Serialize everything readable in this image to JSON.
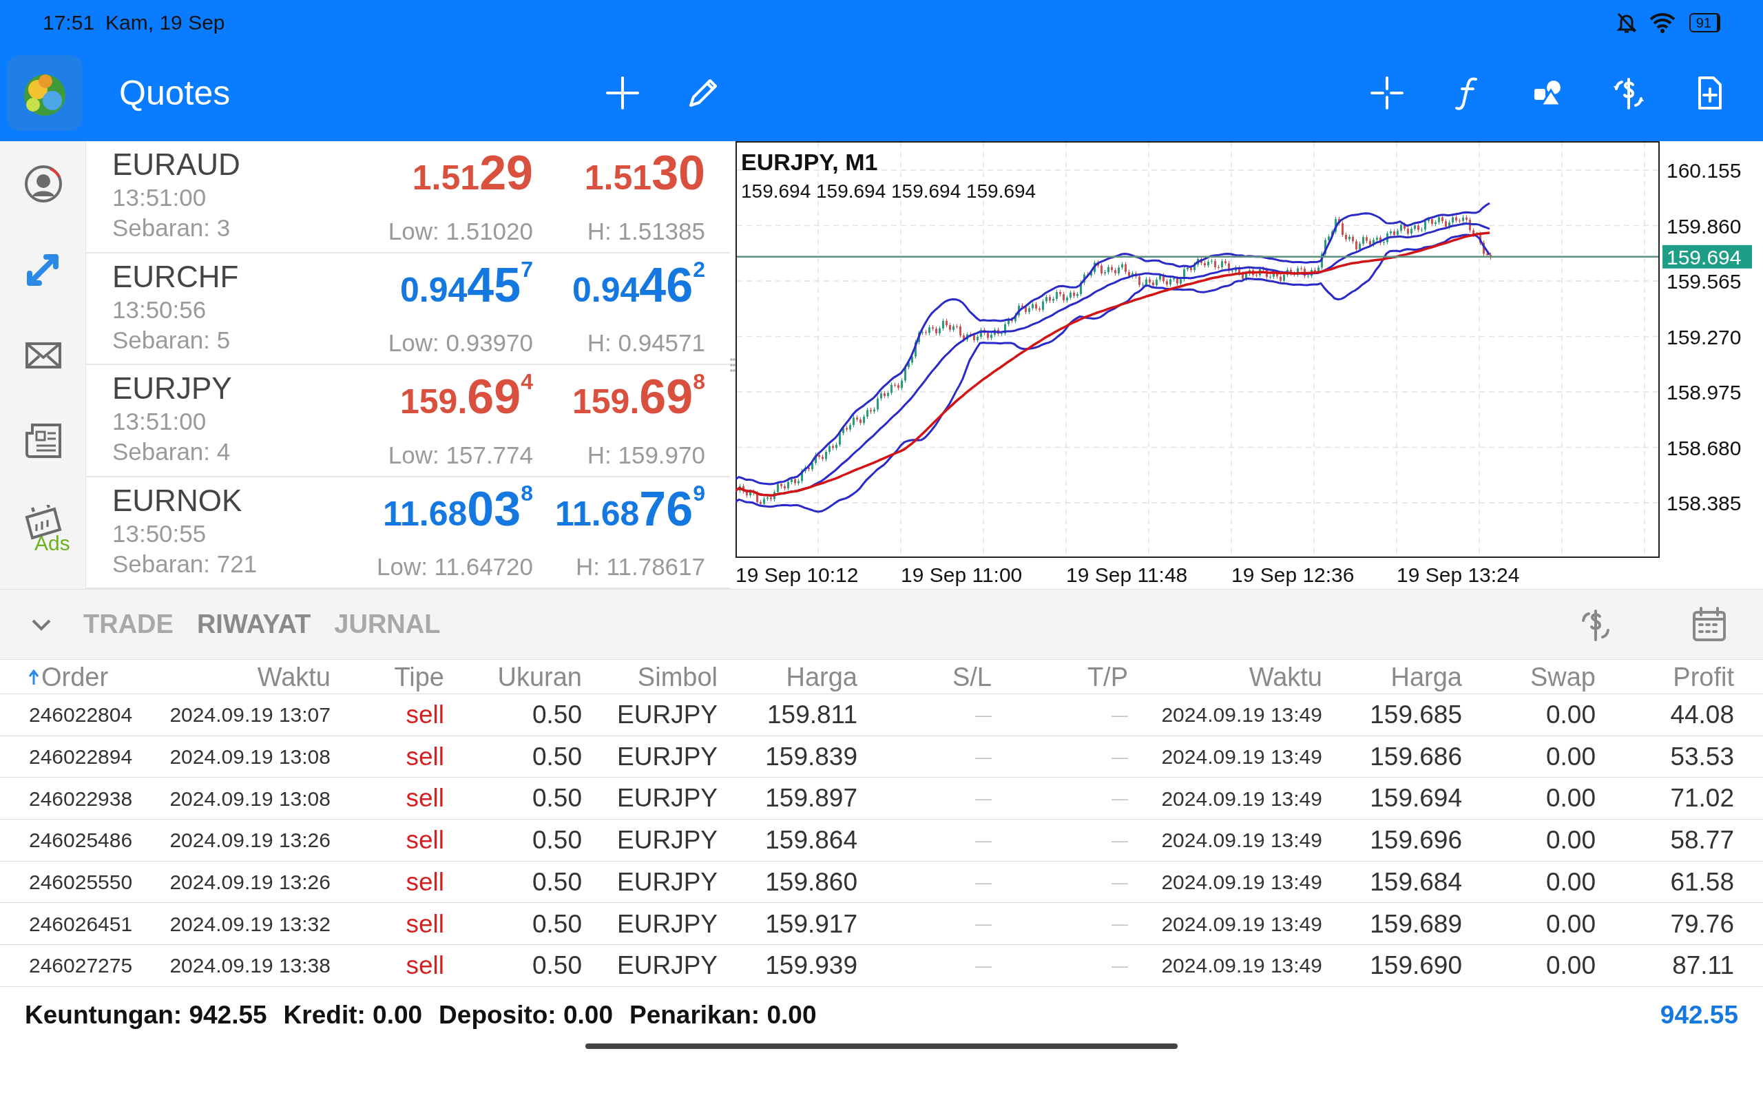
{
  "status_bar": {
    "time": "17:51",
    "date": "Kam, 19 Sep",
    "battery": "91"
  },
  "app_bar": {
    "title": "Quotes"
  },
  "sidebar": {
    "items": [
      {
        "kind": "account",
        "selected": false
      },
      {
        "kind": "trade",
        "selected": true
      },
      {
        "kind": "mail",
        "selected": false
      },
      {
        "kind": "news",
        "selected": false
      },
      {
        "kind": "calendar",
        "selected": false,
        "badge": "Ads"
      }
    ]
  },
  "quotes": [
    {
      "symbol": "EURAUD",
      "time": "13:51:00",
      "spread": "Sebaran: 3",
      "rising": false,
      "bid": {
        "head": "1.51",
        "big": "29"
      },
      "ask": {
        "head": "1.51",
        "big": "30"
      },
      "low": "Low: 1.51020",
      "high": "H: 1.51385"
    },
    {
      "symbol": "EURCHF",
      "time": "13:50:56",
      "spread": "Sebaran: 5",
      "rising": true,
      "bid": {
        "head": "0.94",
        "big": "45",
        "sup": "7"
      },
      "ask": {
        "head": "0.94",
        "big": "46",
        "sup": "2"
      },
      "low": "Low: 0.93970",
      "high": "H: 0.94571"
    },
    {
      "symbol": "EURJPY",
      "time": "13:51:00",
      "spread": "Sebaran: 4",
      "rising": false,
      "bid": {
        "head": "159.",
        "big": "69",
        "sup": "4"
      },
      "ask": {
        "head": "159.",
        "big": "69",
        "sup": "8"
      },
      "low": "Low: 157.774",
      "high": "H: 159.970"
    },
    {
      "symbol": "EURNOK",
      "time": "13:50:55",
      "spread": "Sebaran: 721",
      "rising": true,
      "bid": {
        "head": "11.68",
        "big": "03",
        "sup": "8"
      },
      "ask": {
        "head": "11.68",
        "big": "76",
        "sup": "9"
      },
      "low": "Low: 11.64720",
      "high": "H: 11.78617"
    }
  ],
  "chart": {
    "title": "EURJPY, M1",
    "ohlc": "159.694 159.694 159.694 159.694",
    "price_labels": [
      "160.155",
      "159.860",
      "159.565",
      "159.270",
      "158.975",
      "158.680",
      "158.385"
    ],
    "current_price": "159.694",
    "time_labels": [
      "19 Sep 10:12",
      "19 Sep 11:00",
      "19 Sep 11:48",
      "19 Sep 12:36",
      "19 Sep 13:24"
    ]
  },
  "panel": {
    "tabs": [
      {
        "label": "TRADE",
        "selected": false
      },
      {
        "label": "RIWAYAT",
        "selected": true
      },
      {
        "label": "JURNAL",
        "selected": false
      }
    ],
    "columns": [
      {
        "label": "Order",
        "sorted": true
      },
      {
        "label": "Waktu",
        "sorted": false
      },
      {
        "label": "Tipe",
        "sorted": false
      },
      {
        "label": "Ukuran",
        "sorted": false
      },
      {
        "label": "Simbol",
        "sorted": false
      },
      {
        "label": "Harga",
        "sorted": false
      },
      {
        "label": "S/L",
        "sorted": false
      },
      {
        "label": "T/P",
        "sorted": false
      },
      {
        "label": "Waktu",
        "sorted": false
      },
      {
        "label": "Harga",
        "sorted": false
      },
      {
        "label": "Swap",
        "sorted": false
      },
      {
        "label": "Profit",
        "sorted": false
      }
    ],
    "rows": [
      [
        "246022804",
        "2024.09.19 13:07",
        "sell",
        "0.50",
        "EURJPY",
        "159.811",
        "—",
        "—",
        "2024.09.19 13:49",
        "159.685",
        "0.00",
        "44.08"
      ],
      [
        "246022894",
        "2024.09.19 13:08",
        "sell",
        "0.50",
        "EURJPY",
        "159.839",
        "—",
        "—",
        "2024.09.19 13:49",
        "159.686",
        "0.00",
        "53.53"
      ],
      [
        "246022938",
        "2024.09.19 13:08",
        "sell",
        "0.50",
        "EURJPY",
        "159.897",
        "—",
        "—",
        "2024.09.19 13:49",
        "159.694",
        "0.00",
        "71.02"
      ],
      [
        "246025486",
        "2024.09.19 13:26",
        "sell",
        "0.50",
        "EURJPY",
        "159.864",
        "—",
        "—",
        "2024.09.19 13:49",
        "159.696",
        "0.00",
        "58.77"
      ],
      [
        "246025550",
        "2024.09.19 13:26",
        "sell",
        "0.50",
        "EURJPY",
        "159.860",
        "—",
        "—",
        "2024.09.19 13:49",
        "159.684",
        "0.00",
        "61.58"
      ],
      [
        "246026451",
        "2024.09.19 13:32",
        "sell",
        "0.50",
        "EURJPY",
        "159.917",
        "—",
        "—",
        "2024.09.19 13:49",
        "159.689",
        "0.00",
        "79.76"
      ],
      [
        "246027275",
        "2024.09.19 13:38",
        "sell",
        "0.50",
        "EURJPY",
        "159.939",
        "—",
        "—",
        "2024.09.19 13:49",
        "159.690",
        "0.00",
        "87.11"
      ]
    ],
    "summary": [
      {
        "label": "Keuntungan:",
        "value": "942.55"
      },
      {
        "label": "Kredit:",
        "value": "0.00"
      },
      {
        "label": "Deposito:",
        "value": "0.00"
      },
      {
        "label": "Penarikan:",
        "value": "0.00"
      }
    ],
    "total": "942.55"
  }
}
